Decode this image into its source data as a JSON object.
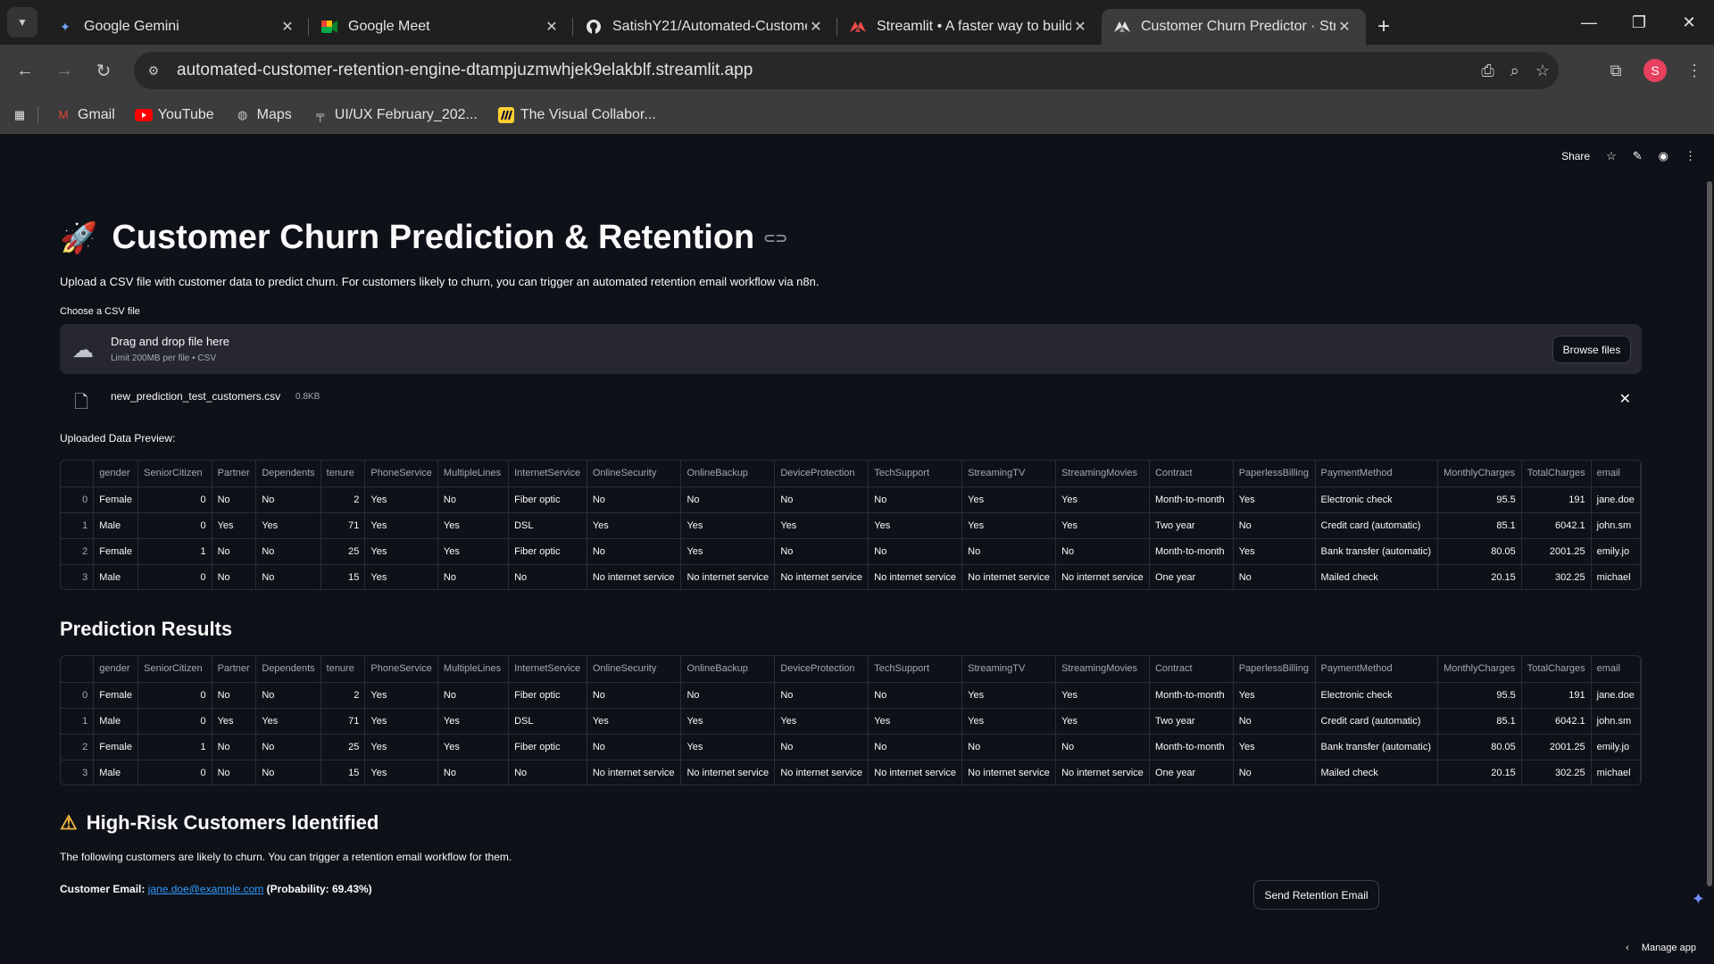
{
  "browser": {
    "tabs": [
      {
        "label": "Google Gemini",
        "icon": "gemini-icon",
        "active": false
      },
      {
        "label": "Google Meet",
        "icon": "meet-icon",
        "active": false
      },
      {
        "label": "SatishY21/Automated-Custome",
        "icon": "github-icon",
        "active": false
      },
      {
        "label": "Streamlit • A faster way to build",
        "icon": "streamlit-icon",
        "active": false
      },
      {
        "label": "Customer Churn Predictor · Stre",
        "icon": "streamlit-icon",
        "active": true
      }
    ],
    "url": "automated-customer-retention-engine-dtampjuzmwhjek9elakblf.streamlit.app",
    "avatar_letter": "S",
    "bookmarks": [
      {
        "label": "Gmail",
        "icon": "gmail-icon"
      },
      {
        "label": "YouTube",
        "icon": "youtube-icon"
      },
      {
        "label": "Maps",
        "icon": "maps-icon"
      },
      {
        "label": "UI/UX February_202...",
        "icon": "bookmark-icon"
      },
      {
        "label": "The Visual Collabor...",
        "icon": "miro-icon"
      }
    ]
  },
  "app": {
    "header": {
      "share_label": "Share"
    },
    "title": "Customer Churn Prediction & Retention",
    "intro": "Upload a CSV file with customer data to predict churn. For customers likely to churn, you can trigger an automated retention email workflow via n8n.",
    "uploader": {
      "label": "Choose a CSV file",
      "drop_title": "Drag and drop file here",
      "drop_sub": "Limit 200MB per file • CSV",
      "browse_label": "Browse files"
    },
    "file": {
      "name": "new_prediction_test_customers.csv",
      "size": "0.8KB"
    },
    "preview_label": "Uploaded Data Preview:",
    "results_heading": "Prediction Results",
    "columns": [
      "",
      "gender",
      "SeniorCitizen",
      "Partner",
      "Dependents",
      "tenure",
      "PhoneService",
      "MultipleLines",
      "InternetService",
      "OnlineSecurity",
      "OnlineBackup",
      "DeviceProtection",
      "TechSupport",
      "StreamingTV",
      "StreamingMovies",
      "Contract",
      "PaperlessBilling",
      "PaymentMethod",
      "MonthlyCharges",
      "TotalCharges",
      "email"
    ],
    "rows": [
      [
        "0",
        "Female",
        "0",
        "No",
        "No",
        "2",
        "Yes",
        "No",
        "Fiber optic",
        "No",
        "No",
        "No",
        "No",
        "Yes",
        "Yes",
        "Month-to-month",
        "Yes",
        "Electronic check",
        "95.5",
        "191",
        "jane.doe"
      ],
      [
        "1",
        "Male",
        "0",
        "Yes",
        "Yes",
        "71",
        "Yes",
        "Yes",
        "DSL",
        "Yes",
        "Yes",
        "Yes",
        "Yes",
        "Yes",
        "Yes",
        "Two year",
        "No",
        "Credit card (automatic)",
        "85.1",
        "6042.1",
        "john.sm"
      ],
      [
        "2",
        "Female",
        "1",
        "No",
        "No",
        "25",
        "Yes",
        "Yes",
        "Fiber optic",
        "No",
        "Yes",
        "No",
        "No",
        "No",
        "No",
        "Month-to-month",
        "Yes",
        "Bank transfer (automatic)",
        "80.05",
        "2001.25",
        "emily.jo"
      ],
      [
        "3",
        "Male",
        "0",
        "No",
        "No",
        "15",
        "Yes",
        "No",
        "No",
        "No internet service",
        "No internet service",
        "No internet service",
        "No internet service",
        "No internet service",
        "No internet service",
        "One year",
        "No",
        "Mailed check",
        "20.15",
        "302.25",
        "michael"
      ]
    ],
    "risk_heading": "High-Risk Customers Identified",
    "risk_text": "The following customers are likely to churn. You can trigger a retention email workflow for them.",
    "customer": {
      "label": "Customer Email:",
      "email": "jane.doe@example.com",
      "probability": "(Probability: 69.43%)"
    },
    "send_button": "Send Retention Email",
    "manage_label": "Manage app"
  }
}
